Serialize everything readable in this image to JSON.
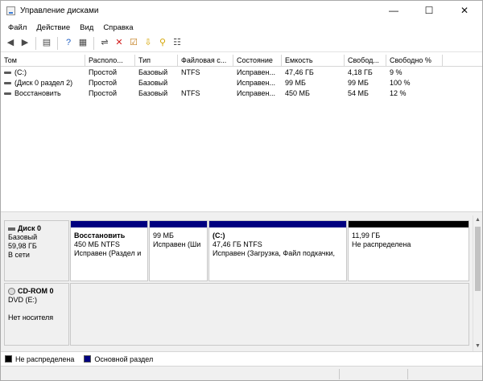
{
  "window": {
    "title": "Управление дисками"
  },
  "window_controls": {
    "minimize": "—",
    "maximize": "☐",
    "close": "✕"
  },
  "menu": [
    "Файл",
    "Действие",
    "Вид",
    "Справка"
  ],
  "toolbar": [
    {
      "icon": "back-arrow-icon",
      "glyph": "◀",
      "color": "#4a4a4a"
    },
    {
      "icon": "forward-arrow-icon",
      "glyph": "▶",
      "color": "#4a4a4a"
    },
    {
      "icon": "console-tree-icon",
      "glyph": "▤",
      "color": "#4a4a4a"
    },
    {
      "icon": "help-icon",
      "glyph": "?",
      "color": "#1f5fc4"
    },
    {
      "icon": "properties-icon",
      "glyph": "▦",
      "color": "#4a4a4a"
    },
    {
      "icon": "connect-disk-icon",
      "glyph": "⇌",
      "color": "#4a4a4a"
    },
    {
      "icon": "delete-icon",
      "glyph": "✕",
      "color": "#d11a1a"
    },
    {
      "icon": "check-icon",
      "glyph": "☑",
      "color": "#c27b1a"
    },
    {
      "icon": "import-icon",
      "glyph": "⇩",
      "color": "#d4a400"
    },
    {
      "icon": "search-icon",
      "glyph": "⚲",
      "color": "#d4a400"
    },
    {
      "icon": "settings-list-icon",
      "glyph": "☷",
      "color": "#4a4a4a"
    }
  ],
  "volumes": {
    "columns": [
      "Том",
      "Располо...",
      "Тип",
      "Файловая с...",
      "Состояние",
      "Емкость",
      "Свобод...",
      "Свободно %"
    ],
    "rows": [
      [
        "(C:)",
        "Простой",
        "Базовый",
        "NTFS",
        "Исправен...",
        "47,46 ГБ",
        "4,18 ГБ",
        "9 %"
      ],
      [
        "(Диск 0 раздел 2)",
        "Простой",
        "Базовый",
        "",
        "Исправен...",
        "99 МБ",
        "99 МБ",
        "100 %"
      ],
      [
        "Восстановить",
        "Простой",
        "Базовый",
        "NTFS",
        "Исправен...",
        "450 МБ",
        "54 МБ",
        "12 %"
      ]
    ]
  },
  "disks": [
    {
      "name": "Диск 0",
      "lines": [
        "Базовый",
        "59,98 ГБ",
        "В сети"
      ],
      "partitions": [
        {
          "name": "Восстановить",
          "size": "450 МБ NTFS",
          "status": "Исправен (Раздел и",
          "bar_color": "#000080"
        },
        {
          "name": "",
          "size": "99 МБ",
          "status": "Исправен (Ши",
          "bar_color": "#000080"
        },
        {
          "name": "(C:)",
          "size": "47,46 ГБ NTFS",
          "status": "Исправен (Загрузка, Файл подкачки,",
          "bar_color": "#000080"
        },
        {
          "name": "",
          "size": "11,99 ГБ",
          "status": "Не распределена",
          "bar_color": "#000000"
        }
      ]
    },
    {
      "name": "CD-ROM 0",
      "lines": [
        "DVD (E:)",
        "",
        "Нет носителя"
      ]
    }
  ],
  "legend": [
    {
      "label": "Не распределена",
      "color": "#000000"
    },
    {
      "label": "Основной раздел",
      "color": "#000080"
    }
  ]
}
